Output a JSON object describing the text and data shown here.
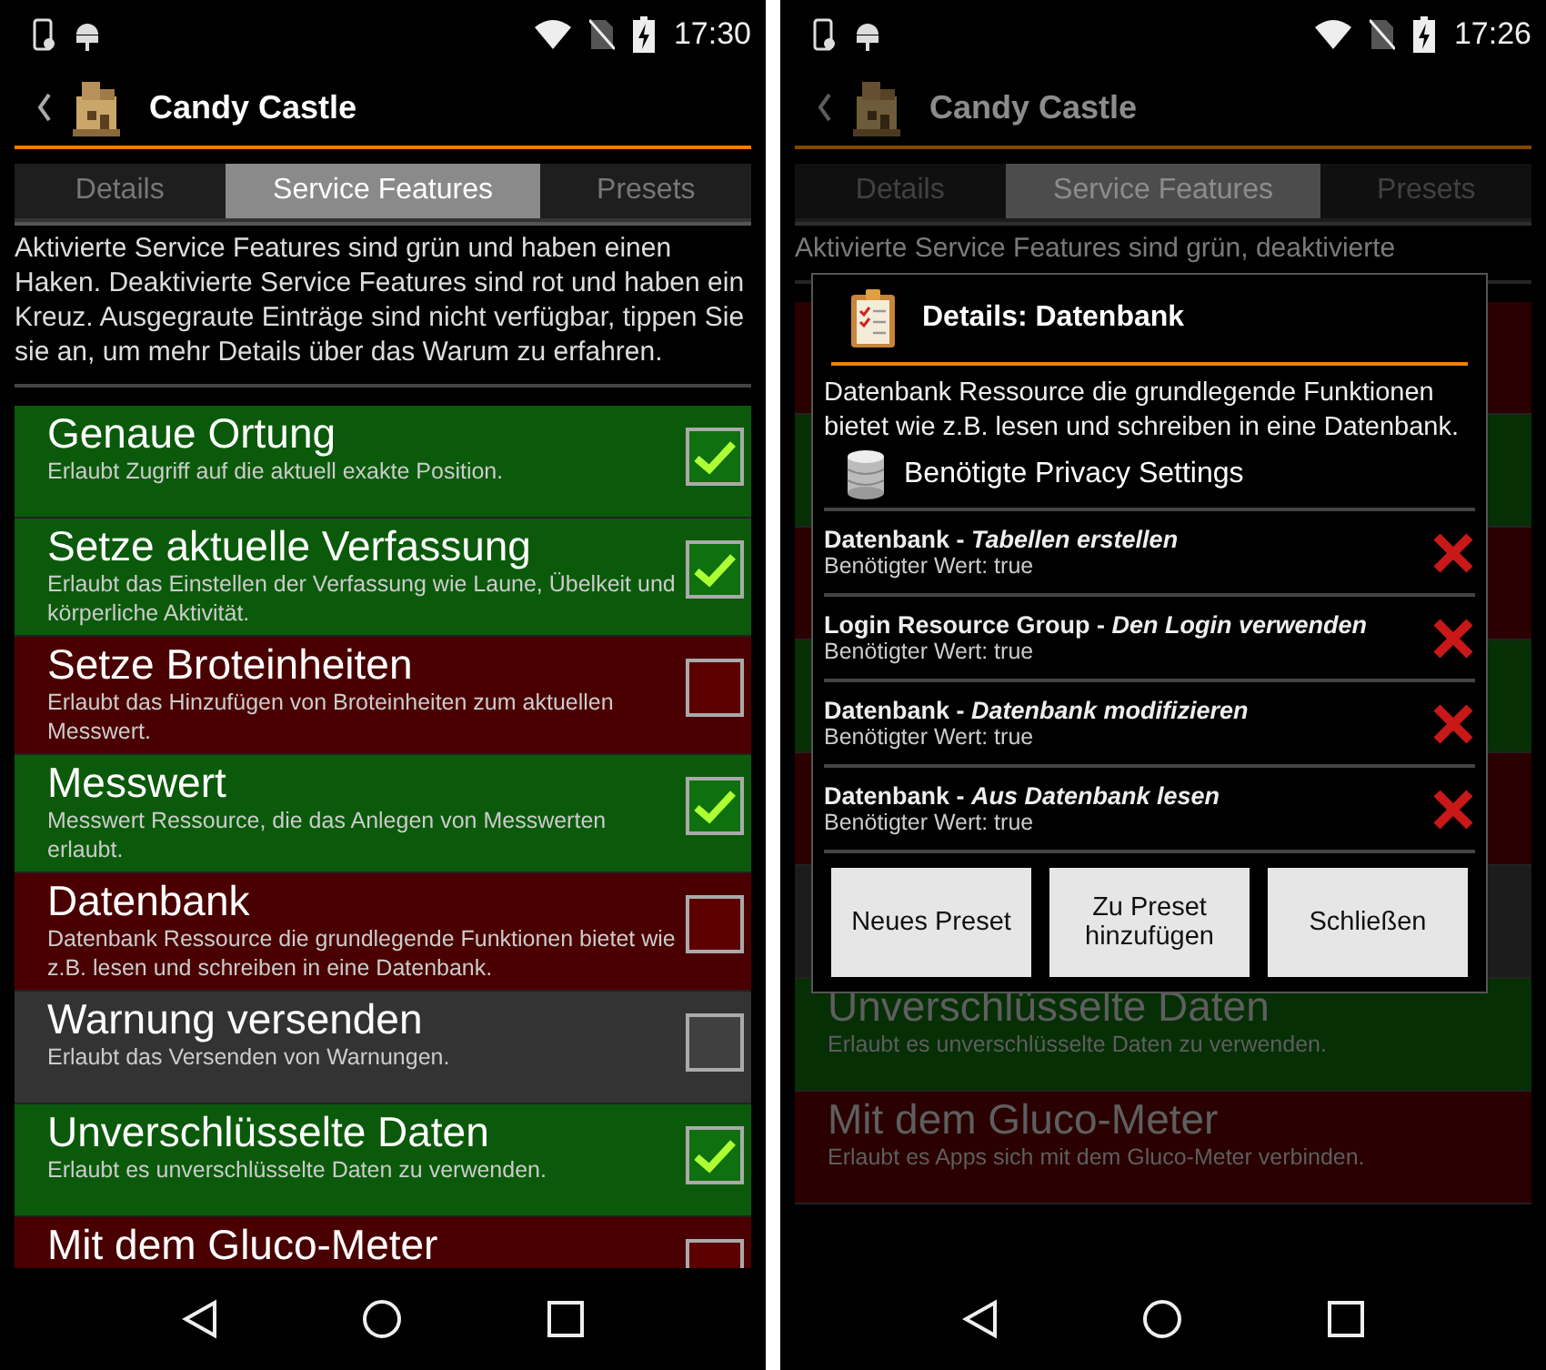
{
  "screens": [
    {
      "status_bar": {
        "time": "17:30"
      },
      "app_bar": {
        "title": "Candy Castle"
      },
      "tabs": [
        {
          "label": "Details",
          "selected": false
        },
        {
          "label": "Service Features",
          "selected": true
        },
        {
          "label": "Presets",
          "selected": false
        }
      ],
      "description": "Aktivierte Service Features sind grün und haben einen Haken. Deaktivierte Service Features sind rot und haben ein Kreuz. Ausgegraute Einträge sind nicht verfügbar, tippen Sie sie an, um mehr Details über das Warum zu erfahren.",
      "features": [
        {
          "title": "Genaue Ortung",
          "description": "Erlaubt Zugriff auf die aktuell exakte Position.",
          "color": "#0b5a0b",
          "checked": true
        },
        {
          "title": "Setze aktuelle Verfassung",
          "description": "Erlaubt das Einstellen der Verfassung wie Laune, Übelkeit und körperliche Aktivität.",
          "color": "#0b5a0b",
          "checked": true
        },
        {
          "title": "Setze Broteinheiten",
          "description": "Erlaubt das Hinzufügen von Broteinheiten zum aktuellen Messwert.",
          "color": "#4a0000",
          "checked": false
        },
        {
          "title": "Messwert",
          "description": "Messwert Ressource, die das Anlegen von Messwerten erlaubt.",
          "color": "#0b5a0b",
          "checked": true
        },
        {
          "title": "Datenbank",
          "description": "Datenbank Ressource die grundlegende Funktionen bietet wie z.B. lesen und schreiben in eine Datenbank.",
          "color": "#4a0000",
          "checked": false
        },
        {
          "title": "Warnung versenden",
          "description": "Erlaubt das Versenden von Warnungen.",
          "color": "#333333",
          "checked": false
        },
        {
          "title": "Unverschlüsselte Daten",
          "description": "Erlaubt es unverschlüsselte Daten zu verwenden.",
          "color": "#0b5a0b",
          "checked": true
        },
        {
          "title": "Mit dem Gluco-Meter",
          "color": "#4a0000",
          "checked": false
        }
      ]
    },
    {
      "status_bar": {
        "time": "17:26"
      },
      "app_bar": {
        "title": "Candy Castle"
      },
      "tabs": [
        {
          "label": "Details",
          "selected": false
        },
        {
          "label": "Service Features",
          "selected": true
        },
        {
          "label": "Presets",
          "selected": false
        }
      ],
      "description": "Aktivierte Service Features sind grün, deaktivierte",
      "features": [
        {
          "color": "#2a0000"
        },
        {
          "color": "#062f06"
        },
        {
          "color": "#2a0000"
        },
        {
          "color": "#062f06"
        },
        {
          "color": "#2a0000"
        },
        {
          "color": "#1c1c1c"
        },
        {
          "title": "Unverschlüsselte Daten",
          "description": "Erlaubt es unverschlüsselte Daten zu verwenden.",
          "color": "#062f06"
        },
        {
          "title": "Mit dem Gluco-Meter",
          "description": "Erlaubt es Apps sich mit dem Gluco-Meter verbinden.",
          "color": "#2a0000"
        }
      ],
      "dialog": {
        "title": "Details: Datenbank",
        "body": "Datenbank Ressource die grundlegende Funktionen bietet wie z.B. lesen und schreiben in eine Datenbank.",
        "section": "Benötigte Privacy Settings",
        "settings": [
          {
            "name": "Datenbank - *Tabellen erstellen*",
            "requirement": "Benötigter Wert: true",
            "granted": false
          },
          {
            "name": "Login Resource Group - *Den Login verwenden*",
            "requirement": "Benötigter Wert: true",
            "granted": false
          },
          {
            "name": "Datenbank - *Datenbank modifizieren*",
            "requirement": "Benötigter Wert: true",
            "granted": false
          },
          {
            "name": "Datenbank - *Aus Datenbank lesen*",
            "requirement": "Benötigter Wert: true",
            "granted": false
          }
        ],
        "buttons": [
          "Neues Preset",
          "Zu Preset hinzufügen",
          "Schließen"
        ]
      }
    }
  ]
}
